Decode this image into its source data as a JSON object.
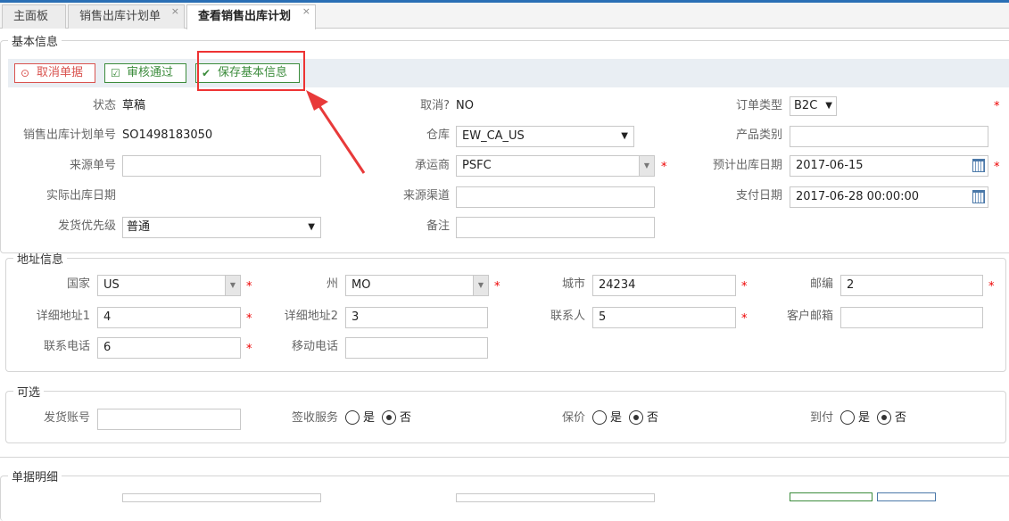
{
  "tabs": [
    {
      "label": "主面板"
    },
    {
      "label": "销售出库计划单"
    },
    {
      "label": "查看销售出库计划"
    }
  ],
  "tab_close": "×",
  "sections": {
    "basic": "基本信息",
    "address": "地址信息",
    "optional": "可选",
    "detail": "单据明细"
  },
  "toolbar": {
    "cancel": "取消单据",
    "approve": "审核通过",
    "save": "保存基本信息"
  },
  "basic": {
    "status_label": "状态",
    "status": "草稿",
    "cancelled_label": "取消?",
    "cancelled": "NO",
    "order_type_label": "订单类型",
    "order_type": "B2C",
    "plan_no_label": "销售出库计划单号",
    "plan_no": "SO1498183050",
    "warehouse_label": "仓库",
    "warehouse": "EW_CA_US",
    "product_type_label": "产品类别",
    "product_type": "",
    "source_no_label": "来源单号",
    "source_no": "",
    "carrier_label": "承运商",
    "carrier": "PSFC",
    "est_date_label": "预计出库日期",
    "est_date": "2017-06-15",
    "actual_date_label": "实际出库日期",
    "channel_label": "来源渠道",
    "channel": "",
    "pay_date_label": "支付日期",
    "pay_date": "2017-06-28 00:00:00",
    "priority_label": "发货优先级",
    "priority": "普通",
    "remark_label": "备注",
    "remark": ""
  },
  "address": {
    "country_label": "国家",
    "country": "US",
    "state_label": "州",
    "state": "MO",
    "city_label": "城市",
    "city": "24234",
    "zip_label": "邮编",
    "zip": "2",
    "addr1_label": "详细地址1",
    "addr1": "4",
    "addr2_label": "详细地址2",
    "addr2": "3",
    "contact_label": "联系人",
    "contact": "5",
    "email_label": "客户邮箱",
    "email": "",
    "phone_label": "联系电话",
    "phone": "6",
    "mobile_label": "移动电话",
    "mobile": ""
  },
  "optional": {
    "account_label": "发货账号",
    "account": "",
    "sign_label": "签收服务",
    "insure_label": "保价",
    "cod_label": "到付",
    "yes": "是",
    "no": "否"
  },
  "required_mark": "*"
}
